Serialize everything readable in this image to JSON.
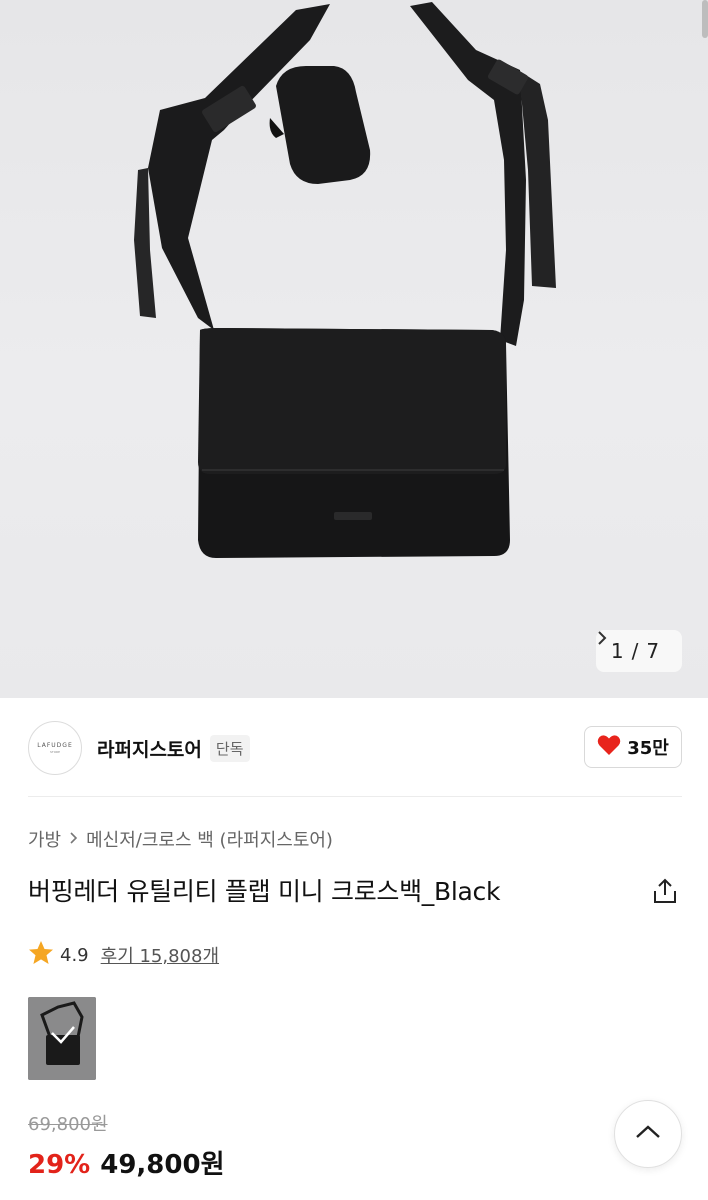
{
  "gallery": {
    "current": "1",
    "separator": "/",
    "total": "7",
    "next_icon": "chevron-right-icon"
  },
  "store": {
    "logo_text": "LAFUDGE",
    "logo_subtext": "STORE",
    "name": "라퍼지스토어",
    "badge": "단독",
    "likes": "35만",
    "like_icon": "heart-icon",
    "heart_color": "#e8241c"
  },
  "breadcrumb": {
    "items": [
      "가방",
      "메신저/크로스 백 (라퍼지스토어)"
    ]
  },
  "product": {
    "title": "버핑레더 유틸리티 플랩 미니 크로스백_Black",
    "rating": "4.9",
    "review_label": "후기 15,808개",
    "star_color": "#f5a623"
  },
  "price": {
    "original": "69,800원",
    "discount": "29%",
    "sale": "49,800원",
    "discount_color": "#e2231a"
  }
}
